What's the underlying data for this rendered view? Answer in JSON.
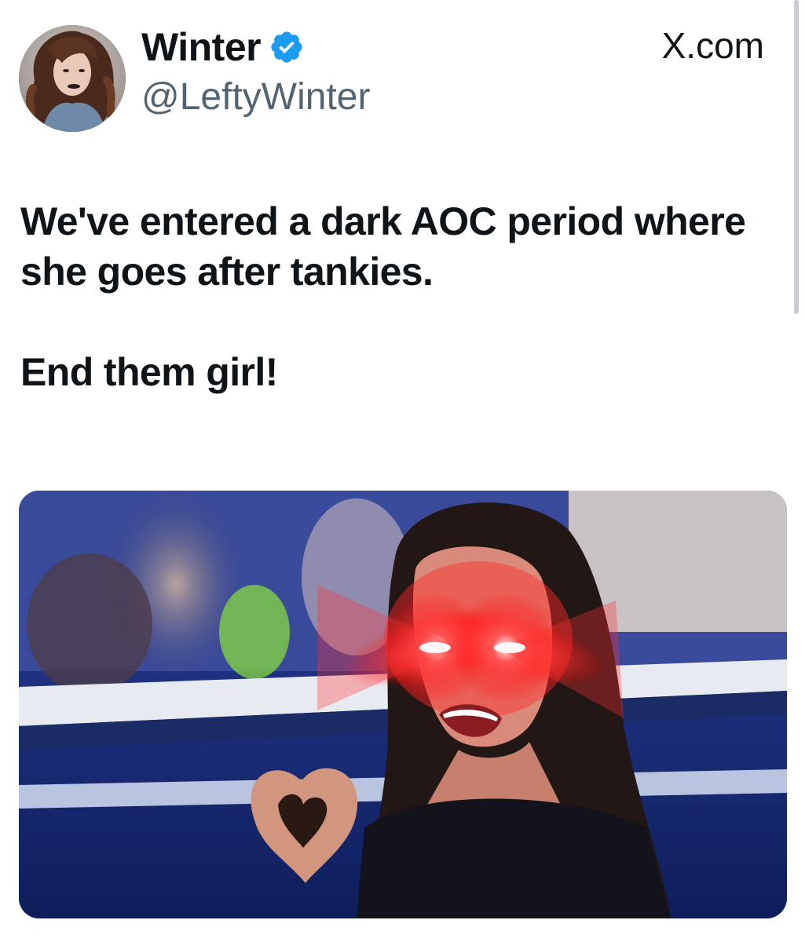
{
  "tweet": {
    "display_name": "Winter",
    "handle": "@LeftyWinter",
    "site_label": "X.com",
    "verified_icon": "verified-badge-icon",
    "paragraphs": [
      "We've entered a  dark AOC period where she goes after tankies.",
      "End them girl!"
    ]
  },
  "colors": {
    "verified": "#1d9bf0",
    "text": "#0f1419",
    "secondary_text": "#536471"
  }
}
